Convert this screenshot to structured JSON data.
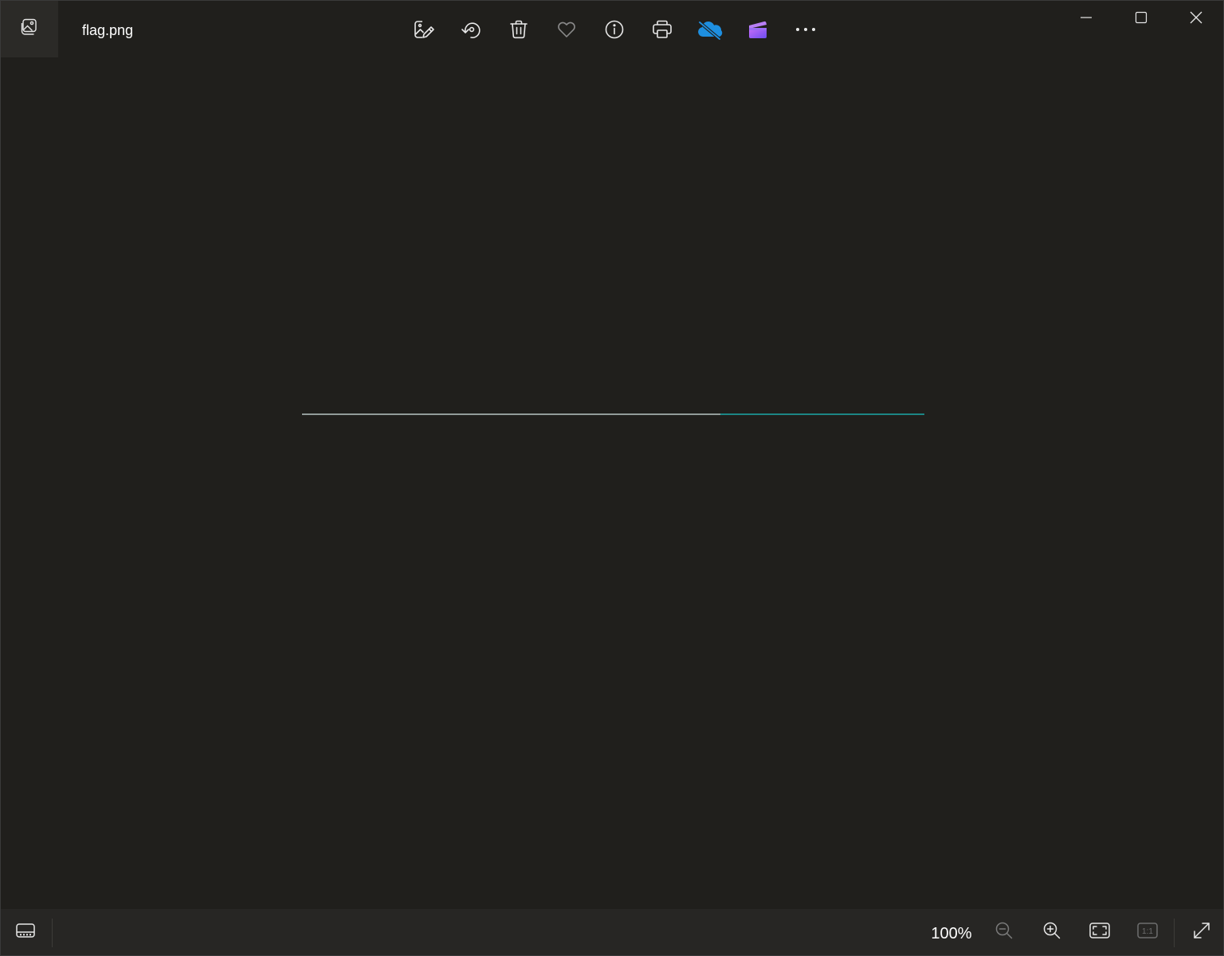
{
  "window": {
    "file_name": "flag.png",
    "app_icon": "photos-app-icon"
  },
  "toolbar": {
    "buttons": [
      {
        "name": "edit-image",
        "icon": "edit-image-icon"
      },
      {
        "name": "rotate",
        "icon": "rotate-icon"
      },
      {
        "name": "delete",
        "icon": "trash-icon"
      },
      {
        "name": "favorite",
        "icon": "heart-icon"
      },
      {
        "name": "file-info",
        "icon": "info-icon"
      },
      {
        "name": "print",
        "icon": "printer-icon"
      },
      {
        "name": "onedrive",
        "icon": "cloud-off-icon"
      },
      {
        "name": "clipchamp",
        "icon": "clipchamp-icon"
      },
      {
        "name": "more-options",
        "icon": "more-icon"
      }
    ]
  },
  "window_controls": {
    "minimize": "minimize-icon",
    "maximize": "maximize-icon",
    "close": "close-icon"
  },
  "bottom_bar": {
    "zoom_level": "100%",
    "buttons": [
      "filmstrip-icon",
      "zoom-out-icon",
      "zoom-in-icon",
      "fit-to-window-icon",
      "actual-size-icon",
      "full-screen-icon"
    ],
    "actual_size_label": "1:1"
  },
  "colors": {
    "background": "#201f1c",
    "bottom_bar": "#272624",
    "onedrive_blue": "#1e8fe0",
    "clipchamp_purple": "#8e5cf6",
    "image_line": "#d8e8e6",
    "image_line_accent": "#19c4c4"
  }
}
